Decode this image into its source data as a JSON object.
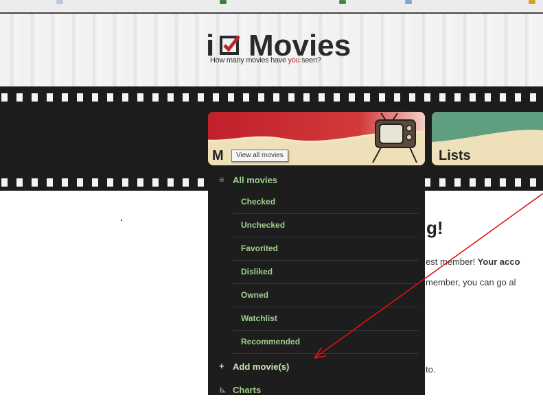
{
  "logo": {
    "i": "i",
    "name": "Movies",
    "tagline_before": "How many movies have ",
    "tagline_you": "you",
    "tagline_after": " seen?"
  },
  "nav": {
    "tabs": [
      {
        "label": "Movies",
        "visible_label": "M",
        "icon": "tv-icon",
        "color": "#c8232c"
      },
      {
        "label": "Lists",
        "color": "#5a9a7a"
      }
    ],
    "tooltip": "View all movies"
  },
  "dropdown": {
    "all_movies": {
      "icon": "menu-icon",
      "label": "All movies"
    },
    "sub_items": [
      "Checked",
      "Unchecked",
      "Favorited",
      "Disliked",
      "Owned",
      "Watchlist",
      "Recommended"
    ],
    "add_movies": {
      "icon": "plus-icon",
      "label": "Add movie(s)"
    },
    "charts": {
      "icon": "chart-icon",
      "label": "Charts"
    }
  },
  "content": {
    "heading_fragment": "g!",
    "line1_start": "est ",
    "line1_member": "member!",
    "line1_end": " Your acco",
    "line2": "member, you can go al",
    "line3": "to."
  },
  "colors": {
    "menu_text": "#9fcf8e",
    "annotation_arrow": "#e01010",
    "film_background": "#1c1c1c"
  }
}
